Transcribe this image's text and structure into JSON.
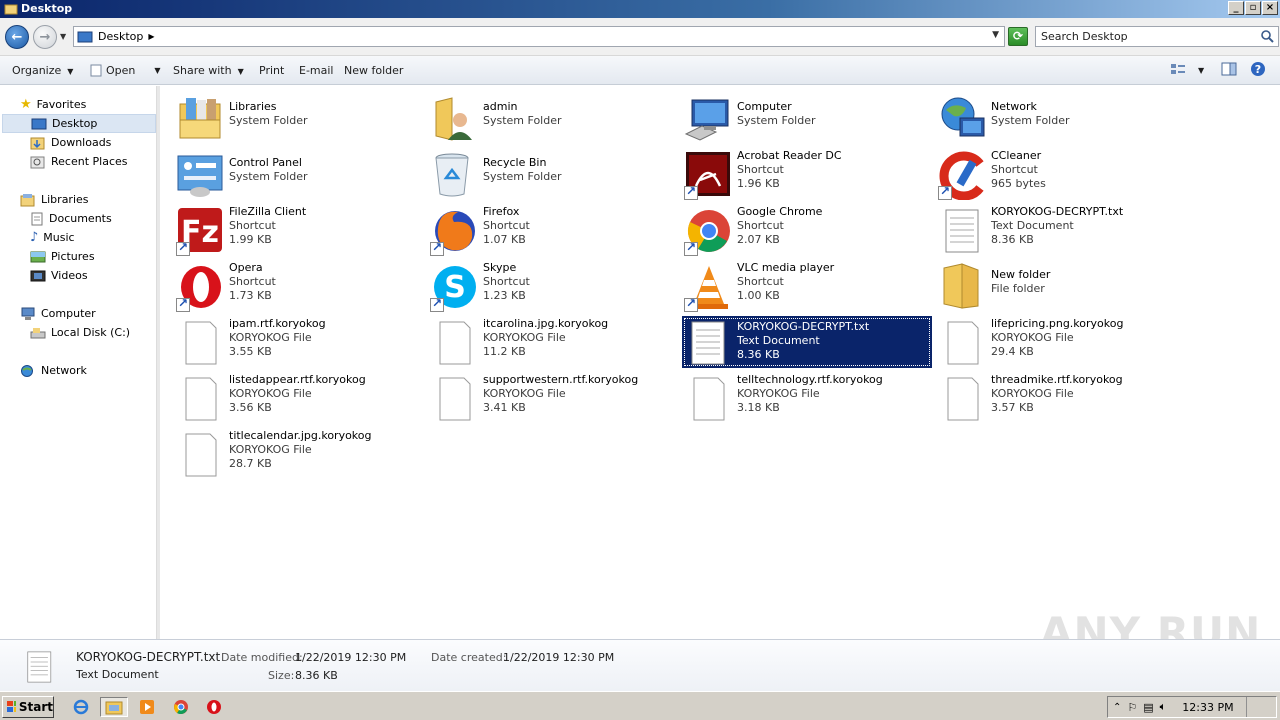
{
  "window": {
    "title": "Desktop"
  },
  "address": {
    "location": "Desktop",
    "search_placeholder": "Search Desktop"
  },
  "toolbar": {
    "organize": "Organize",
    "open": "Open",
    "share_with": "Share with",
    "print": "Print",
    "email": "E-mail",
    "new_folder": "New folder"
  },
  "sidebar": {
    "favorites": "Favorites",
    "desktop": "Desktop",
    "downloads": "Downloads",
    "recent_places": "Recent Places",
    "libraries": "Libraries",
    "documents": "Documents",
    "music": "Music",
    "pictures": "Pictures",
    "videos": "Videos",
    "computer": "Computer",
    "local_disk": "Local Disk (C:)",
    "network": "Network"
  },
  "items": [
    {
      "name": "Libraries",
      "line2": "System Folder",
      "line3": ""
    },
    {
      "name": "admin",
      "line2": "System Folder",
      "line3": ""
    },
    {
      "name": "Computer",
      "line2": "System Folder",
      "line3": ""
    },
    {
      "name": "Network",
      "line2": "System Folder",
      "line3": ""
    },
    {
      "name": "Control Panel",
      "line2": "System Folder",
      "line3": ""
    },
    {
      "name": "Recycle Bin",
      "line2": "System Folder",
      "line3": ""
    },
    {
      "name": "Acrobat Reader DC",
      "line2": "Shortcut",
      "line3": "1.96 KB"
    },
    {
      "name": "CCleaner",
      "line2": "Shortcut",
      "line3": "965 bytes"
    },
    {
      "name": "FileZilla Client",
      "line2": "Shortcut",
      "line3": "1.99 KB"
    },
    {
      "name": "Firefox",
      "line2": "Shortcut",
      "line3": "1.07 KB"
    },
    {
      "name": "Google Chrome",
      "line2": "Shortcut",
      "line3": "2.07 KB"
    },
    {
      "name": "KORYOKOG-DECRYPT.txt",
      "line2": "Text Document",
      "line3": "8.36 KB"
    },
    {
      "name": "Opera",
      "line2": "Shortcut",
      "line3": "1.73 KB"
    },
    {
      "name": "Skype",
      "line2": "Shortcut",
      "line3": "1.23 KB"
    },
    {
      "name": "VLC media player",
      "line2": "Shortcut",
      "line3": "1.00 KB"
    },
    {
      "name": "New folder",
      "line2": "File folder",
      "line3": ""
    },
    {
      "name": "ipam.rtf.koryokog",
      "line2": "KORYOKOG File",
      "line3": "3.55 KB"
    },
    {
      "name": "itcarolina.jpg.koryokog",
      "line2": "KORYOKOG File",
      "line3": "11.2 KB"
    },
    {
      "name": "KORYOKOG-DECRYPT.txt",
      "line2": "Text Document",
      "line3": "8.36 KB"
    },
    {
      "name": "lifepricing.png.koryokog",
      "line2": "KORYOKOG File",
      "line3": "29.4 KB"
    },
    {
      "name": "listedappear.rtf.koryokog",
      "line2": "KORYOKOG File",
      "line3": "3.56 KB"
    },
    {
      "name": "supportwestern.rtf.koryokog",
      "line2": "KORYOKOG File",
      "line3": "3.41 KB"
    },
    {
      "name": "telltechnology.rtf.koryokog",
      "line2": "KORYOKOG File",
      "line3": "3.18 KB"
    },
    {
      "name": "threadmike.rtf.koryokog",
      "line2": "KORYOKOG File",
      "line3": "3.57 KB"
    },
    {
      "name": "titlecalendar.jpg.koryokog",
      "line2": "KORYOKOG File",
      "line3": "28.7 KB"
    }
  ],
  "details": {
    "filename": "KORYOKOG-DECRYPT.txt",
    "filetype": "Text Document",
    "modified_label": "Date modified:",
    "modified_value": "1/22/2019 12:30 PM",
    "created_label": "Date created:",
    "created_value": "1/22/2019 12:30 PM",
    "size_label": "Size:",
    "size_value": "8.36 KB"
  },
  "taskbar": {
    "start": "Start",
    "clock": "12:33 PM"
  },
  "watermark": "ANY RUN"
}
